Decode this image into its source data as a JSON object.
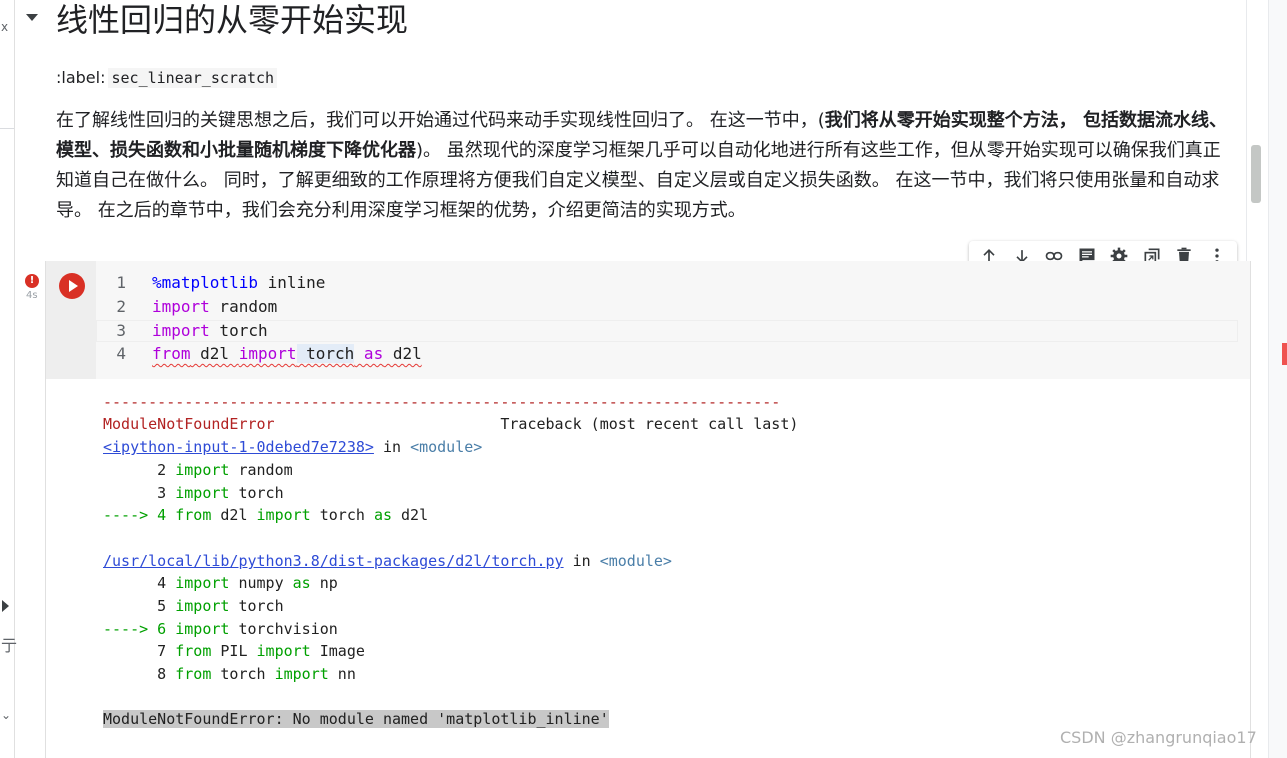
{
  "markdown": {
    "heading": "线性回归的从零开始实现",
    "label_prefix": ":label:",
    "label_code": "sec_linear_scratch",
    "para_1": "在了解线性回归的关键思想之后，我们可以开始通过代码来动手实现线性回归了。 在这一节中，(",
    "para_bold": "我们将从零开始实现整个方法， 包括数据流水线、模型、损失函数和小批量随机梯度下降优化器",
    "para_2": ")。 虽然现代的深度学习框架几乎可以自动化地进行所有这些工作，但从零开始实现可以确保我们真正知道自己在做什么。 同时，了解更细致的工作原理将方便我们自定义模型、自定义层或自定义损失函数。 在这一节中，我们将只使用张量和自动求导。 在之后的章节中，我们会充分利用深度学习框架的优势，介绍更简洁的实现方式。"
  },
  "cell": {
    "error_badge": "!",
    "exec_time": "4s",
    "toolbar": [
      "arrow-up-icon",
      "arrow-down-icon",
      "link-icon",
      "comment-icon",
      "settings-icon",
      "mirror-cell-icon",
      "delete-icon",
      "more-vert-icon"
    ],
    "code_lines": [
      {
        "num": "1",
        "kw": "%matplotlib",
        "rest": " inline"
      },
      {
        "num": "2",
        "kw": "import",
        "rest": " random"
      },
      {
        "num": "3",
        "kw": "import",
        "rest": " torch"
      },
      {
        "num": "4",
        "kw1": "from",
        "mod": " d2l ",
        "kw2": "import",
        "sel": " torch",
        "kw3": " as",
        "rest": " d2l"
      }
    ]
  },
  "output": {
    "dashes": "---------------------------------------------------------------------------",
    "err_name": "ModuleNotFoundError",
    "traceback": "                         Traceback (most recent call last)",
    "file1": "<ipython-input-1-0debed7e7238>",
    "in_text": " in ",
    "module": "<module>",
    "f1_l2_num": "      2 ",
    "f1_l2_kw": "import",
    "f1_l2_rest": " random",
    "f1_l3_num": "      3 ",
    "f1_l3_kw": "import",
    "f1_l3_rest": " torch",
    "f1_l4_arrow": "----> 4 ",
    "f1_l4_kw1": "from",
    "f1_l4_mid": " d2l ",
    "f1_l4_kw2": "import",
    "f1_l4_rest": " torch ",
    "f1_l4_kw3": "as",
    "f1_l4_rest2": " d2l",
    "file2": "/usr/local/lib/python3.8/dist-packages/d2l/torch.py",
    "f2_l4_num": "      4 ",
    "f2_l4_kw": "import",
    "f2_l4_rest": " numpy ",
    "f2_l4_kw2": "as",
    "f2_l4_rest2": " np",
    "f2_l5_num": "      5 ",
    "f2_l5_kw": "import",
    "f2_l5_rest": " torch",
    "f2_l6_arrow": "----> 6 ",
    "f2_l6_kw": "import",
    "f2_l6_rest": " torchvision",
    "f2_l7_num": "      7 ",
    "f2_l7_kw1": "from",
    "f2_l7_mid": " PIL ",
    "f2_l7_kw2": "import",
    "f2_l7_rest": " Image",
    "f2_l8_num": "      8 ",
    "f2_l8_kw1": "from",
    "f2_l8_mid": " torch ",
    "f2_l8_kw2": "import",
    "f2_l8_rest": " nn",
    "final_error": "ModuleNotFoundError: No module named 'matplotlib_inline'"
  },
  "watermark": "CSDN @zhangrunqiao17",
  "left_strip": {
    "glyph_1": "x",
    "glyph_2": "亍",
    "glyph_3": "⌄"
  }
}
